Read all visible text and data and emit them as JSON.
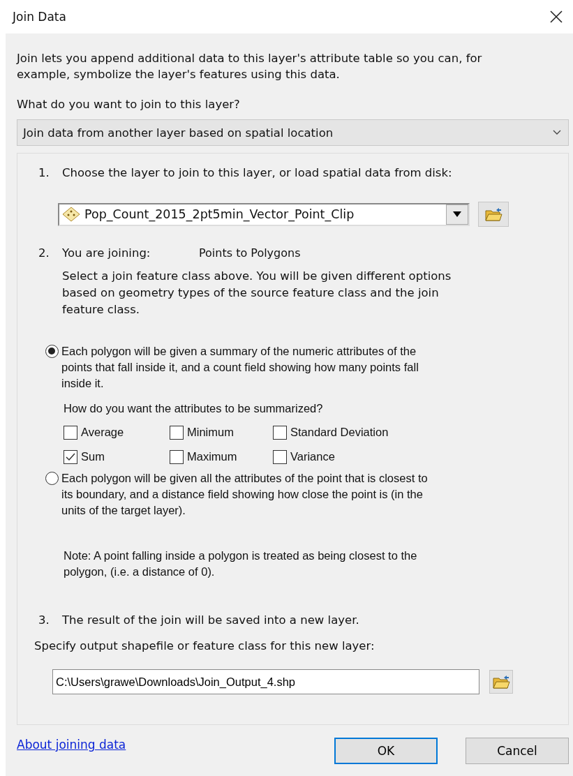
{
  "window": {
    "title": "Join Data"
  },
  "intro": "Join lets you append additional data to this layer's attribute table so you can, for example, symbolize the layer's features using this data.",
  "question": "What do you want to join to this layer?",
  "join_type": {
    "value": "Join data from another layer based on spatial location"
  },
  "step1": {
    "number": "1.",
    "label": "Choose the layer to join to this layer, or load spatial data from disk:",
    "layer": {
      "value": "Pop_Count_2015_2pt5min_Vector_Point_Clip"
    }
  },
  "step2": {
    "number": "2.",
    "label": "You are joining:",
    "join_kind": "Points to Polygons",
    "description": "Select a join feature class above.  You will be given different options based on geometry types of the source feature class and the join feature class."
  },
  "options": [
    {
      "label": "Each polygon will be given a summary of the numeric attributes of the points that fall inside it, and a count field showing how many points fall inside it.",
      "selected": true,
      "summary_question": "How do you want the attributes to be summarized?",
      "statistics": [
        {
          "label": "Average",
          "checked": false
        },
        {
          "label": "Minimum",
          "checked": false
        },
        {
          "label": "Standard Deviation",
          "checked": false
        },
        {
          "label": "Sum",
          "checked": true
        },
        {
          "label": "Maximum",
          "checked": false
        },
        {
          "label": "Variance",
          "checked": false
        }
      ]
    },
    {
      "label": "Each polygon will be given all the attributes of the point that is closest to its boundary, and a distance field showing how close the point is (in the units of the target layer).",
      "selected": false,
      "note": "Note: A point falling inside a polygon is treated as being closest to the polygon, (i.e. a distance of 0)."
    }
  ],
  "step3": {
    "number": "3.",
    "label": "The result of the join will be saved into a new layer.",
    "output_label": "Specify output shapefile or feature class for this new layer:",
    "output": {
      "value": "C:\\Users\\grawe\\Downloads\\Join_Output_4.shp"
    }
  },
  "link": "About joining data",
  "buttons": [
    {
      "label": "OK",
      "default": true
    },
    {
      "label": "Cancel",
      "default": false
    }
  ]
}
